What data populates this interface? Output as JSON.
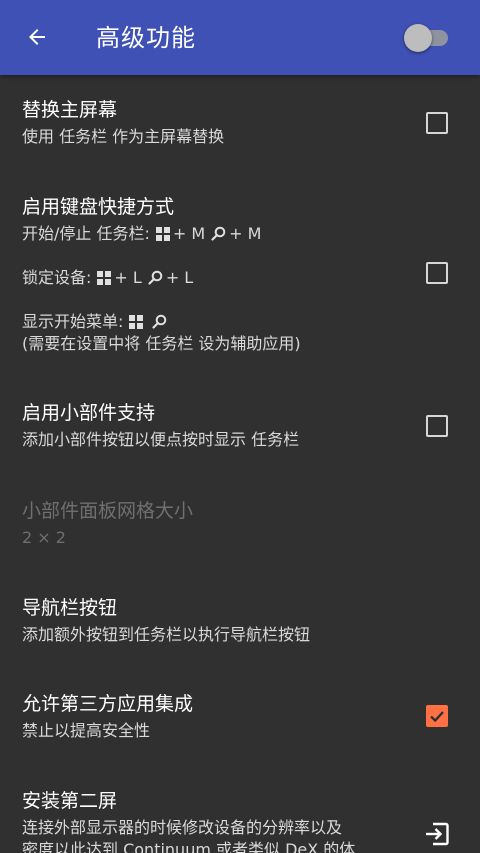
{
  "appbar": {
    "back_icon": "arrow-back-icon",
    "title": "高级功能",
    "switch_enabled": false
  },
  "prefs": {
    "replace_home": {
      "title": "替换主屏幕",
      "summary": "使用 任务栏 作为主屏幕替换",
      "checked": false
    },
    "keyboard_shortcuts": {
      "title": "启用键盘快捷方式",
      "line1_label": "开始/停止 任务栏:",
      "line1_win_keys": "+ M",
      "line1_search_keys": "+ M",
      "line2_label": "锁定设备:",
      "line2_win_keys": "+ L",
      "line2_search_keys": "+ L",
      "line3_label": "显示开始菜单:",
      "line4": "(需要在设置中将 任务栏 设为辅助应用)",
      "checked": false
    },
    "widgets": {
      "title": "启用小部件支持",
      "summary": "添加小部件按钮以便点按时显示 任务栏",
      "checked": false
    },
    "widget_grid": {
      "title": "小部件面板网格大小",
      "summary": "2 × 2",
      "enabled": false
    },
    "nav_buttons": {
      "title": "导航栏按钮",
      "summary": "添加额外按钮到任务栏以执行导航栏按钮"
    },
    "third_party": {
      "title": "允许第三方应用集成",
      "summary": "禁止以提高安全性",
      "checked": true
    },
    "second_screen": {
      "title": "安装第二屏",
      "summary_line1": "连接外部显示器的时候修改设备的分辨率以及",
      "summary_line2": "密度以此达到 Continuum 或者类似 DeX 的体",
      "icon": "exit-to-app-icon"
    }
  },
  "colors": {
    "appbar": "#3f51b5",
    "background": "#303030",
    "accent": "#ff7043"
  }
}
